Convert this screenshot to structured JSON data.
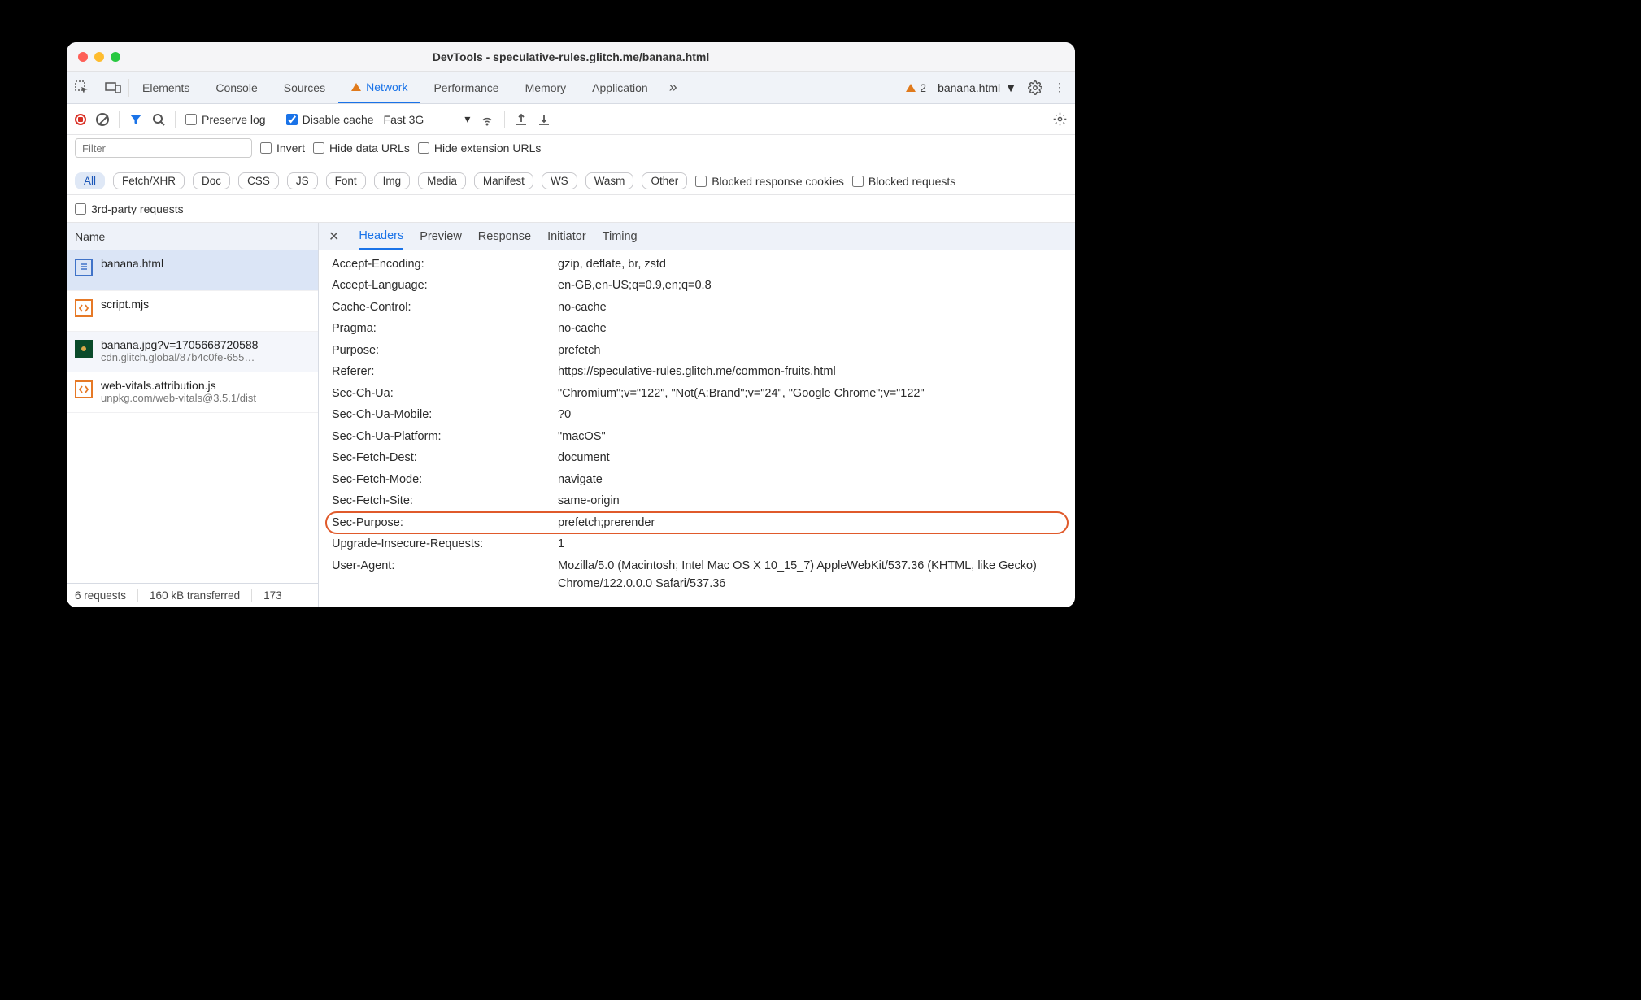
{
  "window": {
    "title": "DevTools - speculative-rules.glitch.me/banana.html"
  },
  "main_tabs": {
    "elements": "Elements",
    "console": "Console",
    "sources": "Sources",
    "network": "Network",
    "performance": "Performance",
    "memory": "Memory",
    "application": "Application",
    "warn_count": "2",
    "context": "banana.html"
  },
  "toolbar": {
    "preserve": "Preserve log",
    "disable_cache": "Disable cache",
    "throttle": "Fast 3G"
  },
  "filters": {
    "placeholder": "Filter",
    "invert": "Invert",
    "hide_data": "Hide data URLs",
    "hide_ext": "Hide extension URLs",
    "types": [
      "All",
      "Fetch/XHR",
      "Doc",
      "CSS",
      "JS",
      "Font",
      "Img",
      "Media",
      "Manifest",
      "WS",
      "Wasm",
      "Other"
    ],
    "blocked_cookies": "Blocked response cookies",
    "blocked_req": "Blocked requests",
    "third_party": "3rd-party requests"
  },
  "sidebar": {
    "head": "Name",
    "items": [
      {
        "name": "banana.html",
        "sub": "",
        "type": "doc"
      },
      {
        "name": "script.mjs",
        "sub": "",
        "type": "js"
      },
      {
        "name": "banana.jpg?v=1705668720588",
        "sub": "cdn.glitch.global/87b4c0fe-655…",
        "type": "img"
      },
      {
        "name": "web-vitals.attribution.js",
        "sub": "unpkg.com/web-vitals@3.5.1/dist",
        "type": "js"
      }
    ]
  },
  "status": {
    "reqs": "6 requests",
    "trans": "160 kB transferred",
    "res": "173"
  },
  "detail_tabs": {
    "headers": "Headers",
    "preview": "Preview",
    "response": "Response",
    "initiator": "Initiator",
    "timing": "Timing"
  },
  "headers": [
    {
      "k": "Accept-Encoding:",
      "v": "gzip, deflate, br, zstd"
    },
    {
      "k": "Accept-Language:",
      "v": "en-GB,en-US;q=0.9,en;q=0.8"
    },
    {
      "k": "Cache-Control:",
      "v": "no-cache"
    },
    {
      "k": "Pragma:",
      "v": "no-cache"
    },
    {
      "k": "Purpose:",
      "v": "prefetch"
    },
    {
      "k": "Referer:",
      "v": "https://speculative-rules.glitch.me/common-fruits.html"
    },
    {
      "k": "Sec-Ch-Ua:",
      "v": "\"Chromium\";v=\"122\", \"Not(A:Brand\";v=\"24\", \"Google Chrome\";v=\"122\""
    },
    {
      "k": "Sec-Ch-Ua-Mobile:",
      "v": "?0"
    },
    {
      "k": "Sec-Ch-Ua-Platform:",
      "v": "\"macOS\""
    },
    {
      "k": "Sec-Fetch-Dest:",
      "v": "document"
    },
    {
      "k": "Sec-Fetch-Mode:",
      "v": "navigate"
    },
    {
      "k": "Sec-Fetch-Site:",
      "v": "same-origin"
    },
    {
      "k": "Sec-Purpose:",
      "v": "prefetch;prerender",
      "hl": true
    },
    {
      "k": "Upgrade-Insecure-Requests:",
      "v": "1"
    },
    {
      "k": "User-Agent:",
      "v": "Mozilla/5.0 (Macintosh; Intel Mac OS X 10_15_7) AppleWebKit/537.36 (KHTML, like Gecko) Chrome/122.0.0.0 Safari/537.36"
    }
  ]
}
